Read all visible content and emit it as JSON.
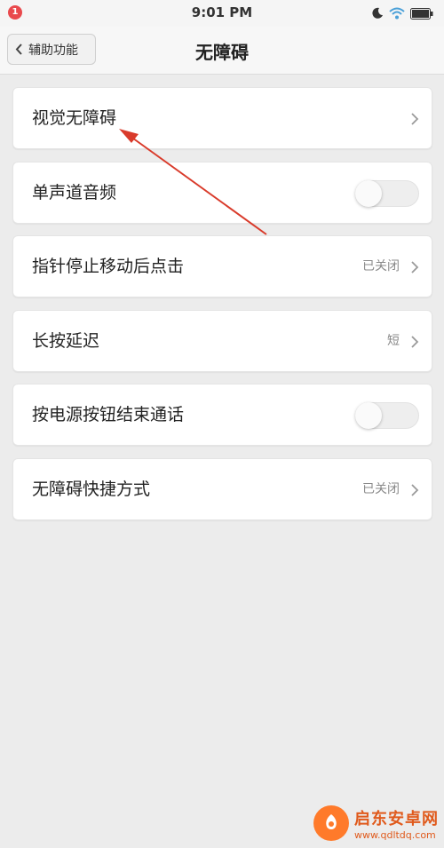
{
  "status_bar": {
    "notification_badge": "1",
    "time": "9:01 PM",
    "icons": [
      "moon-icon",
      "wifi-icon",
      "battery-icon"
    ]
  },
  "nav": {
    "back_label": "辅助功能",
    "title": "无障碍"
  },
  "items": [
    {
      "label": "视觉无障碍",
      "value": "",
      "control": "chevron"
    },
    {
      "label": "单声道音频",
      "value": "",
      "control": "toggle",
      "on": false
    },
    {
      "label": "指针停止移动后点击",
      "value": "已关闭",
      "control": "chevron"
    },
    {
      "label": "长按延迟",
      "value": "短",
      "control": "chevron"
    },
    {
      "label": "按电源按钮结束通话",
      "value": "",
      "control": "toggle",
      "on": false
    },
    {
      "label": "无障碍快捷方式",
      "value": "已关闭",
      "control": "chevron"
    }
  ],
  "watermark": {
    "title": "启东安卓网",
    "url": "www.qdltdq.com"
  },
  "colors": {
    "background": "#ececec",
    "card": "#ffffff",
    "annotation_arrow": "#d93b2b",
    "badge": "#e9494d",
    "watermark": "#e05a1c"
  }
}
